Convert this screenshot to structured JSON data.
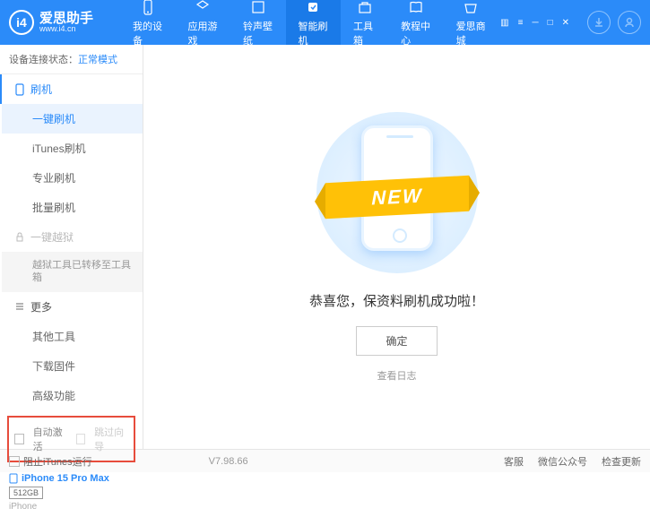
{
  "app": {
    "title": "爱思助手",
    "subtitle": "www.i4.cn"
  },
  "nav": {
    "items": [
      "我的设备",
      "应用游戏",
      "铃声壁纸",
      "智能刷机",
      "工具箱",
      "教程中心",
      "爱思商城"
    ],
    "active_index": 3
  },
  "status": {
    "label": "设备连接状态：",
    "value": "正常模式"
  },
  "sidebar": {
    "flash": {
      "header": "刷机",
      "items": [
        "一键刷机",
        "iTunes刷机",
        "专业刷机",
        "批量刷机"
      ],
      "selected": 0
    },
    "jailbreak": {
      "header": "一键越狱",
      "note": "越狱工具已转移至工具箱"
    },
    "more": {
      "header": "更多",
      "items": [
        "其他工具",
        "下载固件",
        "高级功能"
      ]
    }
  },
  "options": {
    "auto_activate": "自动激活",
    "skip_guide": "跳过向导"
  },
  "device": {
    "name": "iPhone 15 Pro Max",
    "storage": "512GB",
    "type": "iPhone"
  },
  "main": {
    "ribbon": "NEW",
    "success": "恭喜您，保资料刷机成功啦！",
    "ok": "确定",
    "log": "查看日志"
  },
  "footer": {
    "block_itunes": "阻止iTunes运行",
    "version": "V7.98.66",
    "links": [
      "客服",
      "微信公众号",
      "检查更新"
    ]
  }
}
